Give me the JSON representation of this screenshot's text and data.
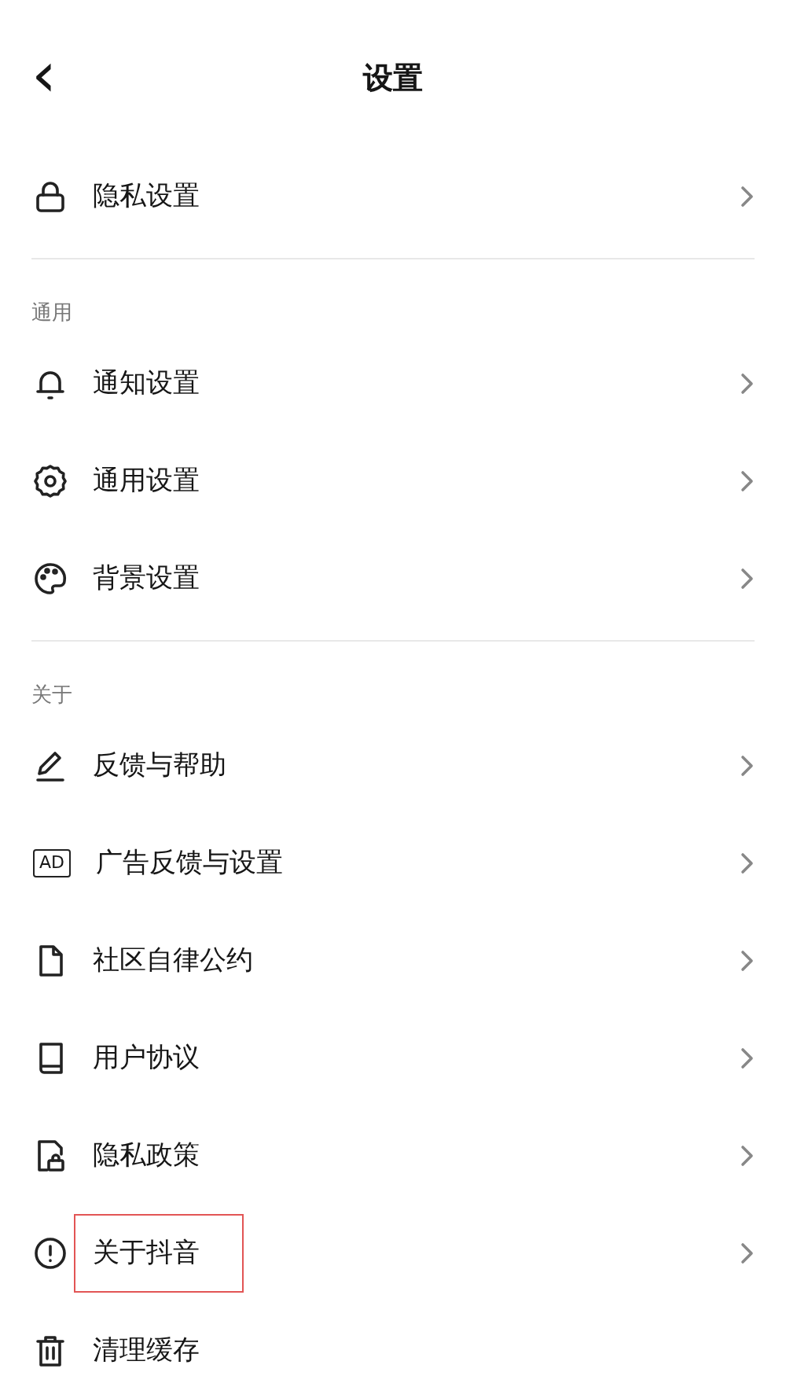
{
  "header": {
    "back": "‹",
    "title": "设置"
  },
  "groups": [
    {
      "items": [
        {
          "label": "隐私设置",
          "chevron": true,
          "highlighted": false
        }
      ]
    },
    {
      "label": "通用",
      "items": [
        {
          "label": "通知设置",
          "chevron": true,
          "highlighted": false
        },
        {
          "label": "通用设置",
          "chevron": true,
          "highlighted": false
        },
        {
          "label": "背景设置",
          "chevron": true,
          "highlighted": false
        }
      ]
    },
    {
      "label": "关于",
      "items": [
        {
          "label": "反馈与帮助",
          "chevron": true,
          "highlighted": false
        },
        {
          "badge": "AD",
          "label": "广告反馈与设置",
          "chevron": true,
          "highlighted": false
        },
        {
          "label": "社区自律公约",
          "chevron": true,
          "highlighted": false
        },
        {
          "label": "用户协议",
          "chevron": true,
          "highlighted": false
        },
        {
          "label": "隐私政策",
          "chevron": true,
          "highlighted": false
        },
        {
          "label": "关于抖音",
          "chevron": true,
          "highlighted": true
        },
        {
          "label": "清理缓存",
          "chevron": false,
          "highlighted": false
        }
      ]
    }
  ]
}
